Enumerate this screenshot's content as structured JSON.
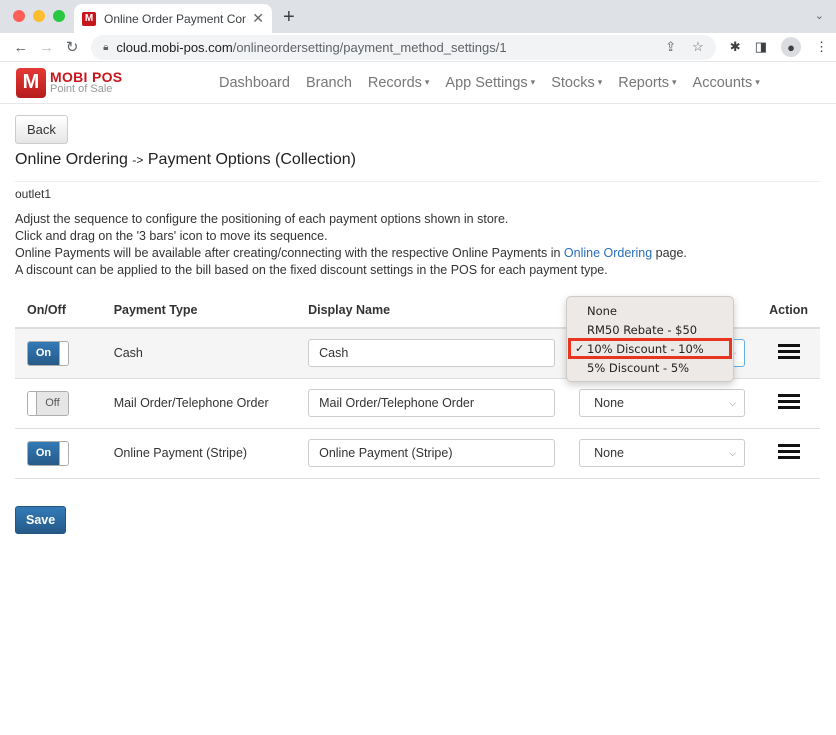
{
  "browser": {
    "tab_title": "Online Order Payment Configu",
    "tab_favicon": "M",
    "url_host": "cloud.mobi-pos.com",
    "url_path": "/onlineordersetting/payment_method_settings/1",
    "icons": [
      "back-arrow-icon",
      "forward-arrow-icon",
      "reload-icon",
      "lock-icon",
      "share-icon",
      "star-icon",
      "extensions-icon",
      "sidebar-icon",
      "profile-icon",
      "menu-dots-icon"
    ]
  },
  "navbar": {
    "brand_name": "MOBI POS",
    "brand_sub": "Point of Sale",
    "logo_letter": "M",
    "items": [
      {
        "label": "Dashboard",
        "dropdown": false
      },
      {
        "label": "Branch",
        "dropdown": false
      },
      {
        "label": "Records",
        "dropdown": true
      },
      {
        "label": "App Settings",
        "dropdown": true
      },
      {
        "label": "Stocks",
        "dropdown": true
      },
      {
        "label": "Reports",
        "dropdown": true
      },
      {
        "label": "Accounts",
        "dropdown": true
      }
    ],
    "caret": "▾"
  },
  "page": {
    "back_label": "Back",
    "title_part1": "Online Ordering",
    "title_arrow": "->",
    "title_part2": "Payment Options (Collection)",
    "outlet": "outlet1",
    "help": {
      "line1": "Adjust the sequence to configure the positioning of each payment options shown in store.",
      "line2": "Click and drag on the '3 bars' icon to move its sequence.",
      "line3_pre": "Online Payments will be available after creating/connecting with the respective Online Payments in ",
      "line3_link": "Online Ordering",
      "line3_post": " page.",
      "line4": "A discount can be applied to the bill based on the fixed discount settings in the POS for each payment type."
    },
    "save_label": "Save"
  },
  "table": {
    "headers": {
      "onoff": "On/Off",
      "type": "Payment Type",
      "display": "Display Name",
      "discount": "",
      "action": "Action"
    },
    "rows": [
      {
        "enabled": true,
        "toggle_label": "On",
        "type": "Cash",
        "display_name": "Cash",
        "discount": "10% Discount - 10%"
      },
      {
        "enabled": false,
        "toggle_label": "Off",
        "type": "Mail Order/Telephone Order",
        "display_name": "Mail Order/Telephone Order",
        "discount": "None"
      },
      {
        "enabled": true,
        "toggle_label": "On",
        "type": "Online Payment (Stripe)",
        "display_name": "Online Payment (Stripe)",
        "discount": "None"
      }
    ]
  },
  "dropdown": {
    "options": [
      "None",
      "RM50 Rebate - $50",
      "10% Discount - 10%",
      "5% Discount - 5%"
    ],
    "selected_index": 2,
    "check": "✓",
    "highlight_color": "#e8351f"
  },
  "colors": {
    "primary": "#337ab7",
    "brand": "#c8161d",
    "link": "#2a6ebb"
  }
}
